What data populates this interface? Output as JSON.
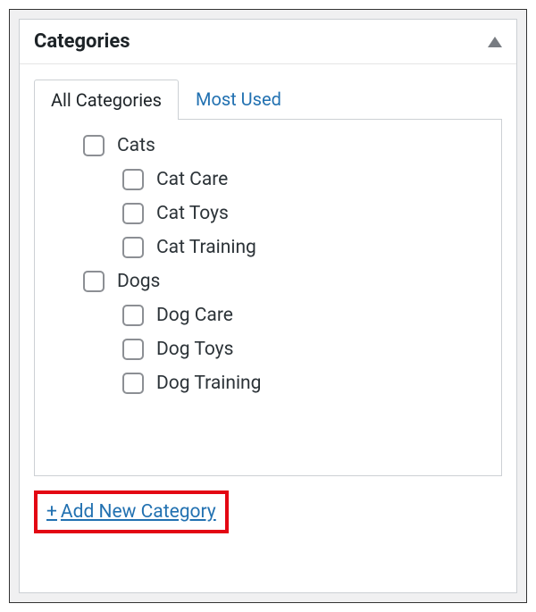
{
  "panel": {
    "title": "Categories"
  },
  "tabs": {
    "all": "All Categories",
    "most_used": "Most Used"
  },
  "categories": [
    {
      "label": "Cats",
      "level": 0
    },
    {
      "label": "Cat Care",
      "level": 1
    },
    {
      "label": "Cat Toys",
      "level": 1
    },
    {
      "label": "Cat Training",
      "level": 1
    },
    {
      "label": "Dogs",
      "level": 0
    },
    {
      "label": "Dog Care",
      "level": 1
    },
    {
      "label": "Dog Toys",
      "level": 1
    },
    {
      "label": "Dog Training",
      "level": 1
    }
  ],
  "add_new": {
    "plus": "+",
    "label": "Add New Category"
  }
}
